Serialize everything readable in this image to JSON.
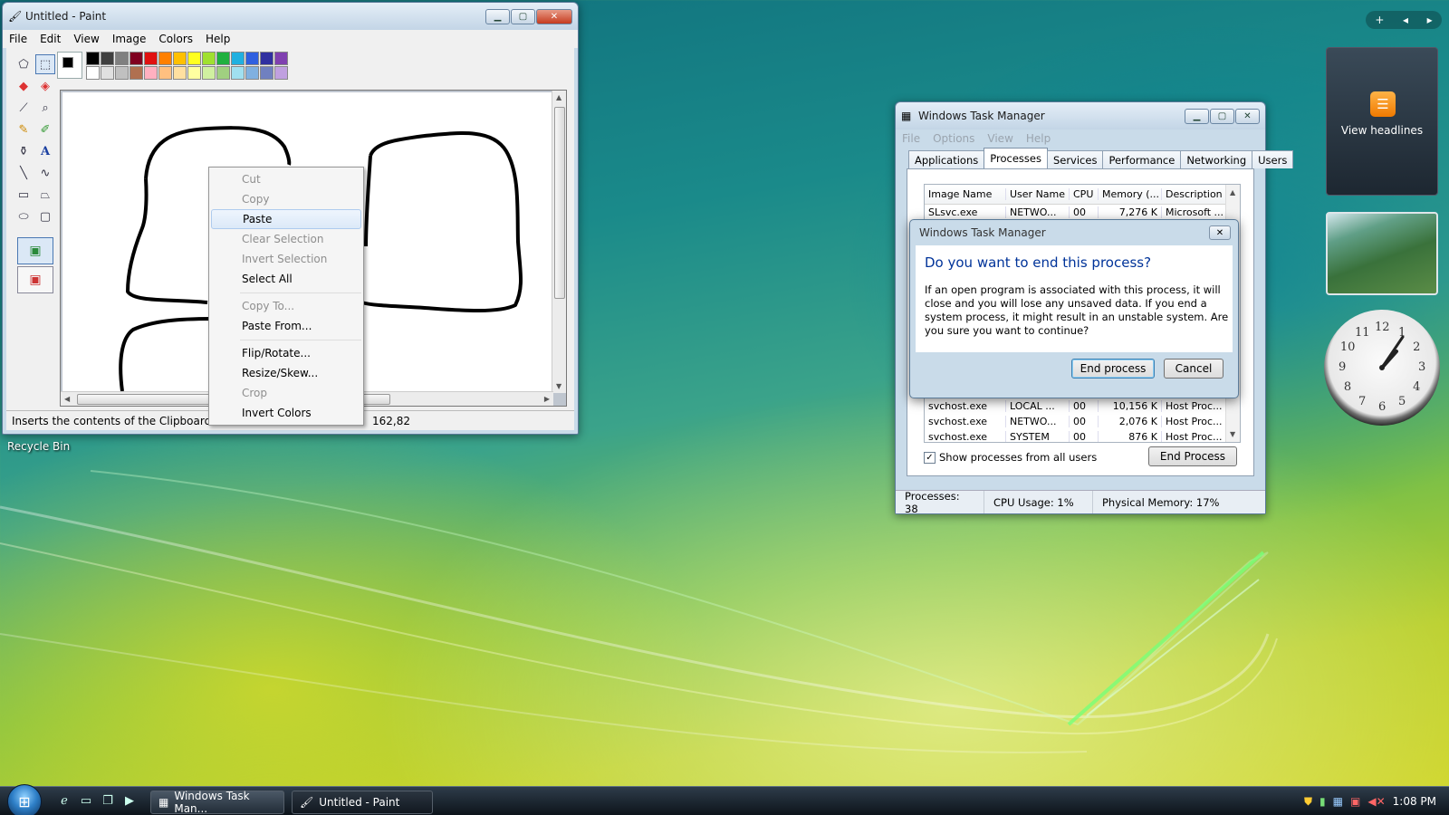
{
  "paint": {
    "title": "Untitled - Paint",
    "menu": [
      "File",
      "Edit",
      "View",
      "Image",
      "Colors",
      "Help"
    ],
    "palette_top": [
      "#000000",
      "#404040",
      "#808080",
      "#800020",
      "#e01010",
      "#ff8000",
      "#ffc000",
      "#ffff20",
      "#a0e030",
      "#20b040",
      "#20b0e0",
      "#3060e0",
      "#3030a0",
      "#8040b0"
    ],
    "palette_bottom": [
      "#ffffff",
      "#e0e0e0",
      "#c0c0c0",
      "#b07050",
      "#ffb0c0",
      "#ffc080",
      "#ffe0a0",
      "#ffffa0",
      "#d0f0a0",
      "#a0d080",
      "#a0e0f0",
      "#80b0e0",
      "#7080c0",
      "#c0a0e0"
    ],
    "status_text": "Inserts the contents of the Clipboard.",
    "coords": "162,82"
  },
  "context_menu": {
    "items": [
      {
        "label": "Cut",
        "enabled": false
      },
      {
        "label": "Copy",
        "enabled": false
      },
      {
        "label": "Paste",
        "enabled": true,
        "hover": true
      },
      {
        "label": "Clear Selection",
        "enabled": false
      },
      {
        "label": "Invert Selection",
        "enabled": false
      },
      {
        "label": "Select All",
        "enabled": true
      },
      {
        "label": "Copy To...",
        "enabled": false
      },
      {
        "label": "Paste From...",
        "enabled": true
      },
      {
        "label": "Flip/Rotate...",
        "enabled": true
      },
      {
        "label": "Resize/Skew...",
        "enabled": true
      },
      {
        "label": "Crop",
        "enabled": false
      },
      {
        "label": "Invert Colors",
        "enabled": true
      }
    ]
  },
  "desktop": {
    "recycle_bin": "Recycle Bin"
  },
  "taskmgr": {
    "title": "Windows Task Manager",
    "menu": [
      "File",
      "Options",
      "View",
      "Help"
    ],
    "tabs": [
      "Applications",
      "Processes",
      "Services",
      "Performance",
      "Networking",
      "Users"
    ],
    "active_tab": "Processes",
    "columns": [
      "Image Name",
      "User Name",
      "CPU",
      "Memory (...",
      "Description"
    ],
    "rows_top": [
      [
        "SLsvc.exe",
        "NETWO...",
        "00",
        "7,276 K",
        "Microsoft ..."
      ]
    ],
    "rows_bottom": [
      [
        "svchost.exe",
        "LOCAL ...",
        "00",
        "10,156 K",
        "Host Proc..."
      ],
      [
        "svchost.exe",
        "NETWO...",
        "00",
        "2,076 K",
        "Host Proc..."
      ],
      [
        "svchost.exe",
        "SYSTEM",
        "00",
        "876 K",
        "Host Proc..."
      ]
    ],
    "show_all_label": "Show processes from all users",
    "end_process_button": "End Process",
    "status": {
      "processes": "Processes: 38",
      "cpu": "CPU Usage: 1%",
      "memory": "Physical Memory: 17%"
    }
  },
  "dialog": {
    "title": "Windows Task Manager",
    "heading": "Do you want to end this process?",
    "message": "If an open program is associated with this process, it will close and you will lose any unsaved data. If you end a system process, it might result in an unstable system. Are you sure you want to continue?",
    "confirm": "End process",
    "cancel": "Cancel"
  },
  "sidebar": {
    "feed_label": "View headlines",
    "clock_numbers": [
      "12",
      "1",
      "2",
      "3",
      "4",
      "5",
      "6",
      "7",
      "8",
      "9",
      "10",
      "11"
    ]
  },
  "taskbar": {
    "buttons": [
      {
        "label": "Windows Task Man...",
        "active": false
      },
      {
        "label": "Untitled - Paint",
        "active": true
      }
    ],
    "time": "1:08 PM"
  },
  "colors": {
    "dialog_heading": "#003399",
    "menu_disabled": "#8e8e8e"
  }
}
